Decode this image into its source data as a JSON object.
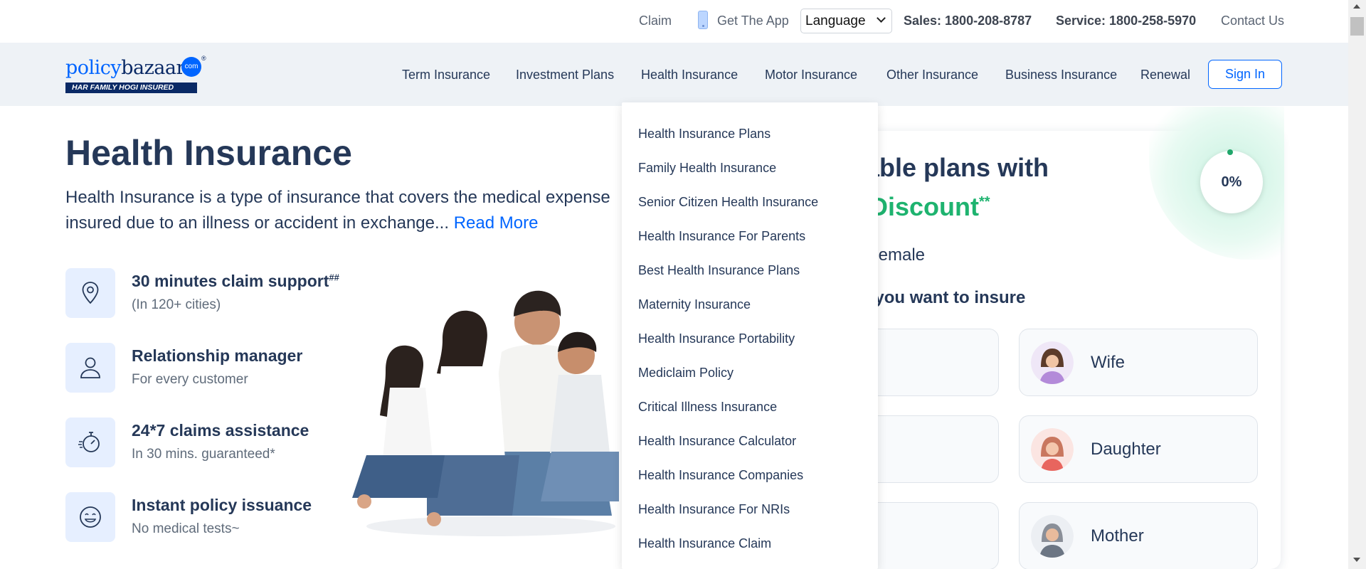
{
  "topbar": {
    "claim": "Claim",
    "get_app": "Get The App",
    "language": "Language",
    "sales": "Sales: 1800-208-8787",
    "service": "Service: 1800-258-5970",
    "contact": "Contact Us"
  },
  "logo": {
    "word1": "policy",
    "word2": "bazaar",
    "dot_com": "com",
    "reg": "®",
    "tagline": "HAR FAMILY HOGI INSURED"
  },
  "nav": {
    "items": [
      "Term Insurance",
      "Investment Plans",
      "Health Insurance",
      "Motor Insurance",
      "Other Insurance",
      "Business Insurance",
      "Renewal"
    ],
    "sign_in": "Sign In"
  },
  "main": {
    "title": "Health Insurance",
    "desc_line1": "Health Insurance is a type of insurance that covers the medical expense",
    "desc_line2": "insured due to an illness or accident in exchange...",
    "read_more": "Read More",
    "features": [
      {
        "title": "30 minutes claim support",
        "sup": "##",
        "sub": "(In 120+ cities)",
        "icon": "location-pin-icon"
      },
      {
        "title": "Relationship manager",
        "sup": "",
        "sub": "For every customer",
        "icon": "person-icon"
      },
      {
        "title": "24*7 claims assistance",
        "sup": "",
        "sub": "In 30 mins. guaranteed*",
        "icon": "stopwatch-icon"
      },
      {
        "title": "Instant policy issuance",
        "sup": "",
        "sub": "No medical tests~",
        "icon": "smiley-icon"
      }
    ]
  },
  "card": {
    "title1": "rdable plans with",
    "title2": "% Discount",
    "title2_sup": "**",
    "gender": "Female",
    "question": "rs you want to insure",
    "progress": "0%",
    "members": [
      "Wife",
      "Daughter",
      "Mother"
    ]
  },
  "dropdown": {
    "items": [
      "Health Insurance Plans",
      "Family Health Insurance",
      "Senior Citizen Health Insurance",
      "Health Insurance For Parents",
      "Best Health Insurance Plans",
      "Maternity Insurance",
      "Health Insurance Portability",
      "Mediclaim Policy",
      "Critical Illness Insurance",
      "Health Insurance Calculator",
      "Health Insurance Companies",
      "Health Insurance For NRIs",
      "Health Insurance Claim"
    ]
  },
  "colors": {
    "brand_blue": "#0065ff",
    "navy": "#253858",
    "green": "#1eb36f",
    "nav_bg": "#eef2f6"
  }
}
